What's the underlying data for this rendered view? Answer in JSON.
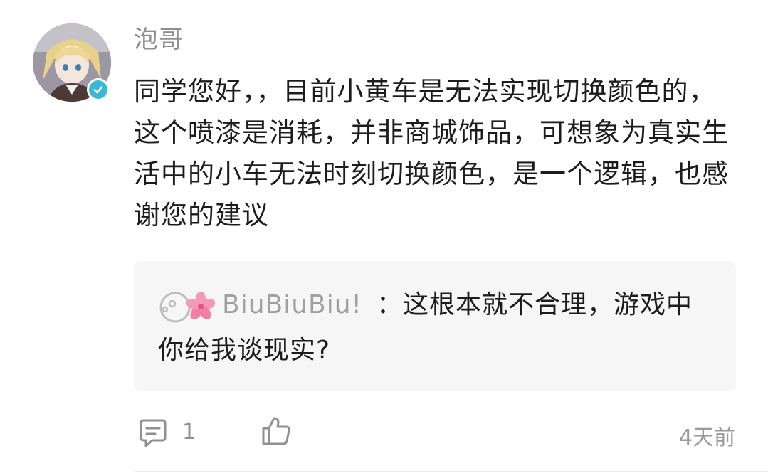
{
  "comment": {
    "username": "泡哥",
    "verified": true,
    "text": "同学您好，，目前小黄车是无法实现切换颜色的，这个喷漆是消耗，并非商城饰品，可想象为真实生活中的小车无法时刻切换颜色，是一个逻辑，也感谢您的建议"
  },
  "reply": {
    "username": "BiuBiuBiu!",
    "separator": "：",
    "text": "这根本就不合理，游戏中你给我谈现实?"
  },
  "footer": {
    "comment_count": "1",
    "timestamp": "4天前"
  },
  "icons": {
    "comment": "comment-icon",
    "like": "thumbs-up-icon",
    "verified": "verified-check-icon"
  },
  "colors": {
    "verified_badge": "#3bb8d8",
    "username": "#8f8f8f",
    "reply_background": "#f6f6f6",
    "sakura": "#f07fa3"
  }
}
